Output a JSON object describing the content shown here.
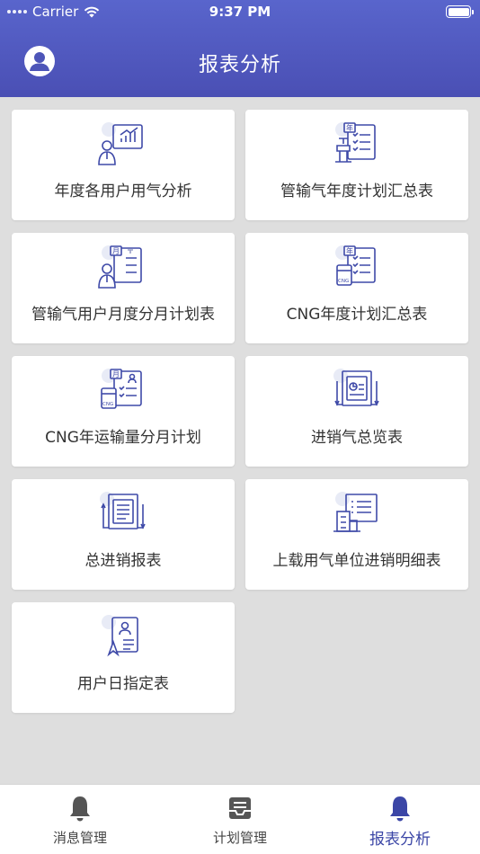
{
  "status_bar": {
    "carrier": "Carrier",
    "time": "9:37 PM"
  },
  "header": {
    "title": "报表分析",
    "avatar_icon": "user-avatar-icon"
  },
  "reports": [
    {
      "label": "年度各用户用气分析",
      "icon": "user-chart-icon"
    },
    {
      "label": "管输气年度计划汇总表",
      "icon": "pipeline-year-checklist-icon"
    },
    {
      "label": "管输气用户月度分月计划表",
      "icon": "pipeline-user-month-plan-icon"
    },
    {
      "label": "CNG年度计划汇总表",
      "icon": "cng-year-checklist-icon"
    },
    {
      "label": "CNG年运输量分月计划",
      "icon": "cng-month-transport-icon"
    },
    {
      "label": "进销气总览表",
      "icon": "gas-overview-report-icon"
    },
    {
      "label": "总进销报表",
      "icon": "total-sales-report-icon"
    },
    {
      "label": "上载用气单位进销明细表",
      "icon": "building-detail-list-icon"
    },
    {
      "label": "用户日指定表",
      "icon": "user-daily-nomination-icon"
    }
  ],
  "tabbar": {
    "tabs": [
      {
        "label": "消息管理",
        "icon": "bell-icon",
        "active": false
      },
      {
        "label": "计划管理",
        "icon": "inbox-tray-icon",
        "active": false
      },
      {
        "label": "报表分析",
        "icon": "bell-icon",
        "active": true
      }
    ]
  },
  "colors": {
    "accent": "#4a4fb4",
    "header_top": "#5965cc",
    "icon_blue": "#3f4aa8",
    "icon_bubble": "#e8ebf6",
    "tab_active": "#3b46a6",
    "tab_inactive": "#555555"
  }
}
